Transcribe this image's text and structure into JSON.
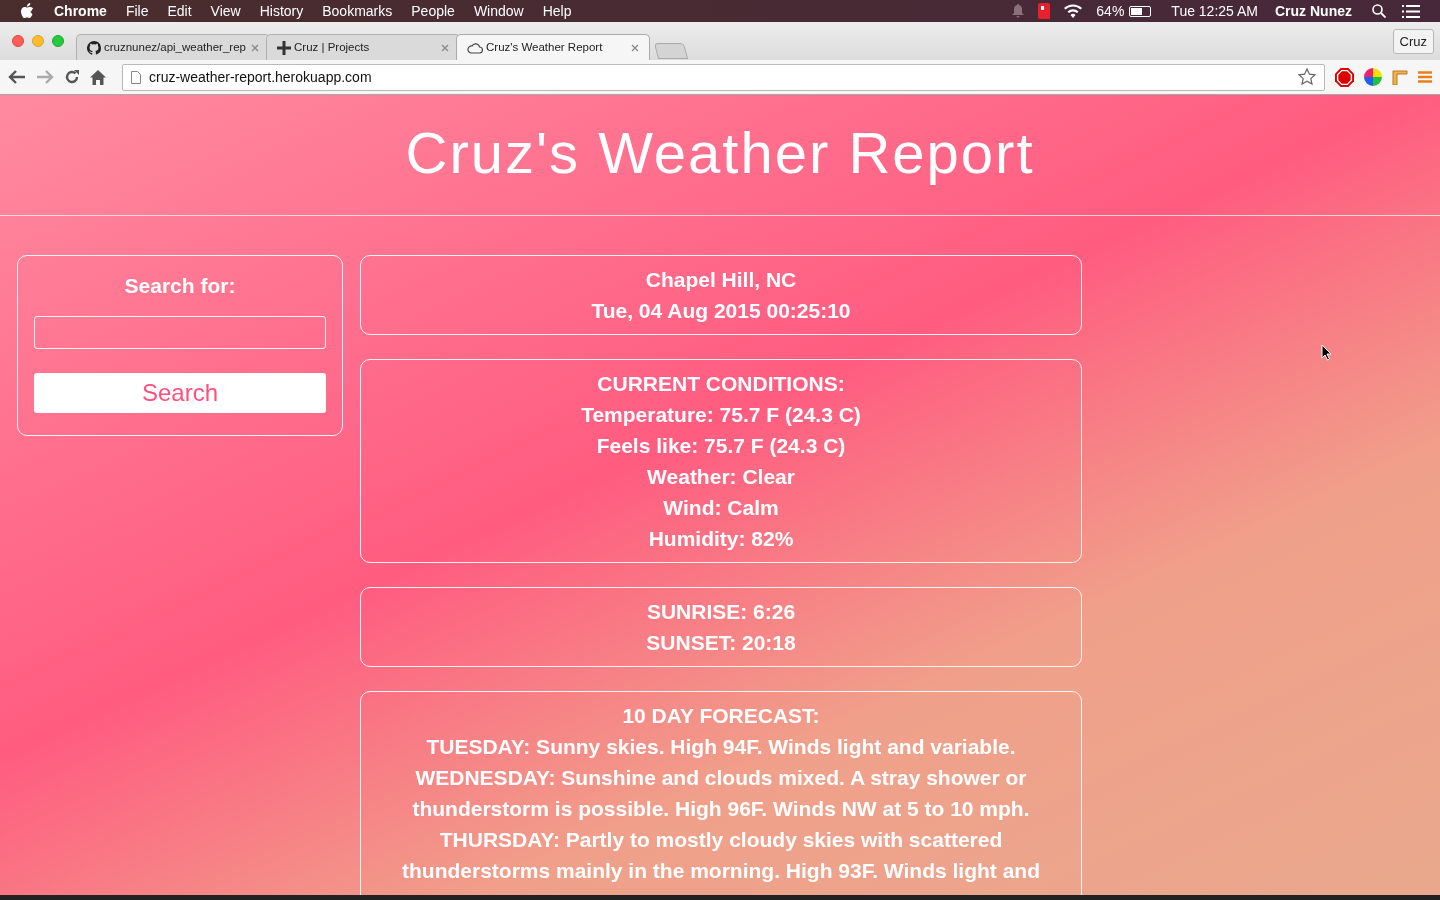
{
  "menu_bar": {
    "app": "Chrome",
    "items": [
      "File",
      "Edit",
      "View",
      "History",
      "Bookmarks",
      "People",
      "Window",
      "Help"
    ],
    "battery": "64%",
    "clock": "Tue 12:25 AM",
    "user": "Cruz Nunez"
  },
  "tabs": [
    {
      "title": "cruznunez/api_weather_rep",
      "kind": "github",
      "selected": false
    },
    {
      "title": "Cruz | Projects",
      "kind": "plus",
      "selected": false
    },
    {
      "title": "Cruz's Weather Report",
      "kind": "cloud",
      "selected": true
    }
  ],
  "profile_button": "Cruz",
  "address": "cruz-weather-report.herokuapp.com",
  "page": {
    "title": "Cruz's Weather Report",
    "search": {
      "label": "Search for:",
      "button": "Search"
    },
    "location": [
      "Chapel Hill, NC",
      "Tue, 04 Aug 2015 00:25:10"
    ],
    "conditions": [
      "CURRENT CONDITIONS:",
      "Temperature: 75.7 F (24.3 C)",
      "Feels like: 75.7 F (24.3 C)",
      "Weather: Clear",
      "Wind: Calm",
      "Humidity: 82%"
    ],
    "sun": [
      "SUNRISE: 6:26",
      "SUNSET: 20:18"
    ],
    "forecast": [
      "10 DAY FORECAST:",
      "TUESDAY: Sunny skies. High 94F. Winds light and variable.",
      "WEDNESDAY: Sunshine and clouds mixed. A stray shower or thunderstorm is possible. High 96F. Winds NW at 5 to 10 mph.",
      "THURSDAY: Partly to mostly cloudy skies with scattered thunderstorms mainly in the morning. High 93F. Winds light and"
    ]
  }
}
